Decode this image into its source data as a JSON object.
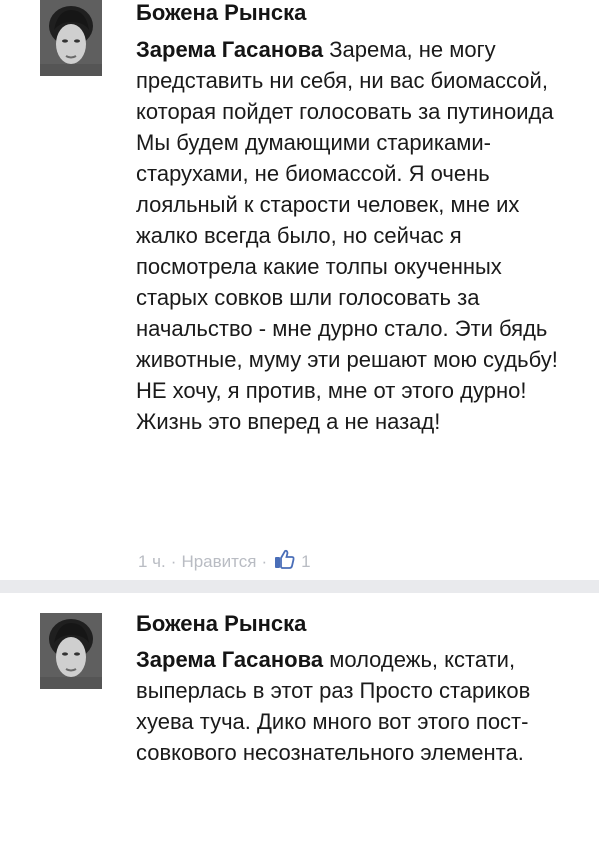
{
  "comments": [
    {
      "author": "Божена Рынска",
      "mention": "Зарема Гасанова",
      "text": " Зарема, не могу представить ни себя, ни вас биомассой, которая пойдет голосовать за путиноида Мы будем думающими стариками-старухами, не биомассой. Я очень лояльный к старости человек, мне их жалко всегда было, но сейчас я посмотрела какие толпы окученных старых совков шли голосовать за начальство - мне дурно стало. Эти бядь животные, муму эти решают мою судьбу! НЕ хочу, я против, мне от этого дурно! Жизнь это вперед а не назад!",
      "time": "1 ч.",
      "separator1": "·",
      "like_label": "Нравится",
      "separator2": "·",
      "like_count": "1"
    },
    {
      "author": "Божена Рынска",
      "mention": "Зарема Гасанова",
      "text": " молодежь, кстати, выперлась в этот раз Просто стариков хуева туча. Дико много вот этого пост-совкового несознательного элемента."
    }
  ],
  "colors": {
    "background": "#e9eaed",
    "card": "#ffffff",
    "meta_text": "#b9bcc3",
    "like_icon": "#4a6eb8"
  },
  "icons": {
    "like": "thumbs-up-icon"
  }
}
